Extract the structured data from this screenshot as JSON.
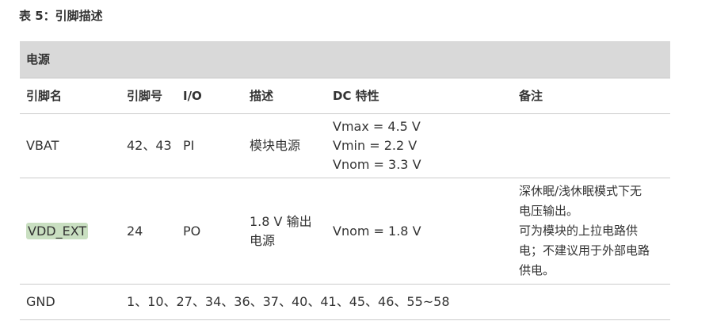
{
  "caption": "表 5：引脚描述",
  "section_title": "电源",
  "headers": [
    "引脚名",
    "引脚号",
    "I/O",
    "描述",
    "DC 特性",
    "备注"
  ],
  "rows": [
    {
      "name": "VBAT",
      "pins": "42、43",
      "io": "PI",
      "desc": "模块电源",
      "dc": [
        "Vmax = 4.5 V",
        "Vmin = 2.2 V",
        "Vnom = 3.3 V"
      ],
      "note": []
    },
    {
      "name": "VDD_EXT",
      "name_highlight": "#c9dfc1",
      "pins": "24",
      "io": "PO",
      "desc": [
        "1.8 V 输出",
        "电源"
      ],
      "dc": [
        "Vnom = 1.8 V"
      ],
      "note": [
        "深休眠/浅休眠模式下无",
        "电压输出。",
        "可为模块的上拉电路供",
        "电；不建议用于外部电路",
        "供电。"
      ]
    },
    {
      "name": "GND",
      "pins": "1、10、27、34、36、37、40、41、45、46、55~58"
    }
  ]
}
